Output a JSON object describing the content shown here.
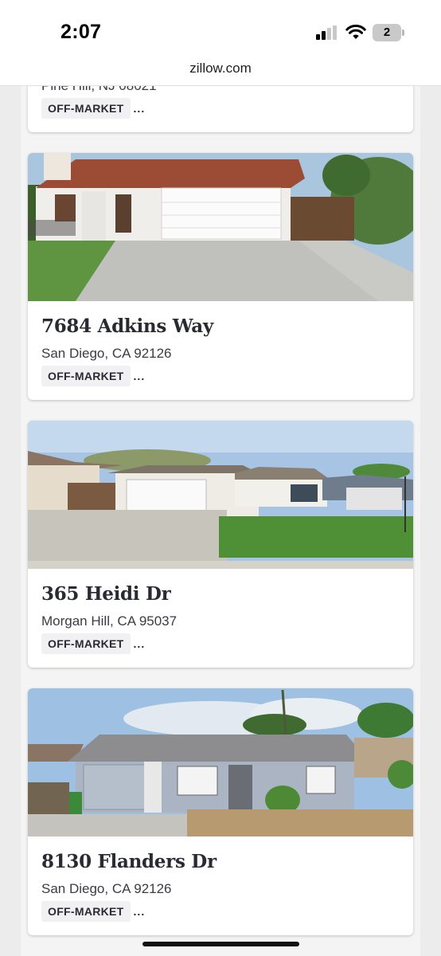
{
  "status_bar": {
    "time": "2:07",
    "battery_level": "2"
  },
  "browser": {
    "url": "zillow.com"
  },
  "listings": [
    {
      "address": "",
      "city": "Pine Hill, NJ 08021",
      "status": "OFF-MARKET",
      "more_icon": "more-icon"
    },
    {
      "address": "7684 Adkins Way",
      "city": "San Diego, CA 92126",
      "status": "OFF-MARKET",
      "more_icon": "more-icon"
    },
    {
      "address": "365 Heidi Dr",
      "city": "Morgan Hill, CA 95037",
      "status": "OFF-MARKET",
      "more_icon": "more-icon"
    },
    {
      "address": "8130 Flanders Dr",
      "city": "San Diego, CA 92126",
      "status": "OFF-MARKET",
      "more_icon": "more-icon"
    }
  ],
  "more_glyph": "...",
  "colors": {
    "text_primary": "#2a2a33",
    "badge_bg": "#f1f1f4",
    "page_bg": "#f4f4f4"
  }
}
